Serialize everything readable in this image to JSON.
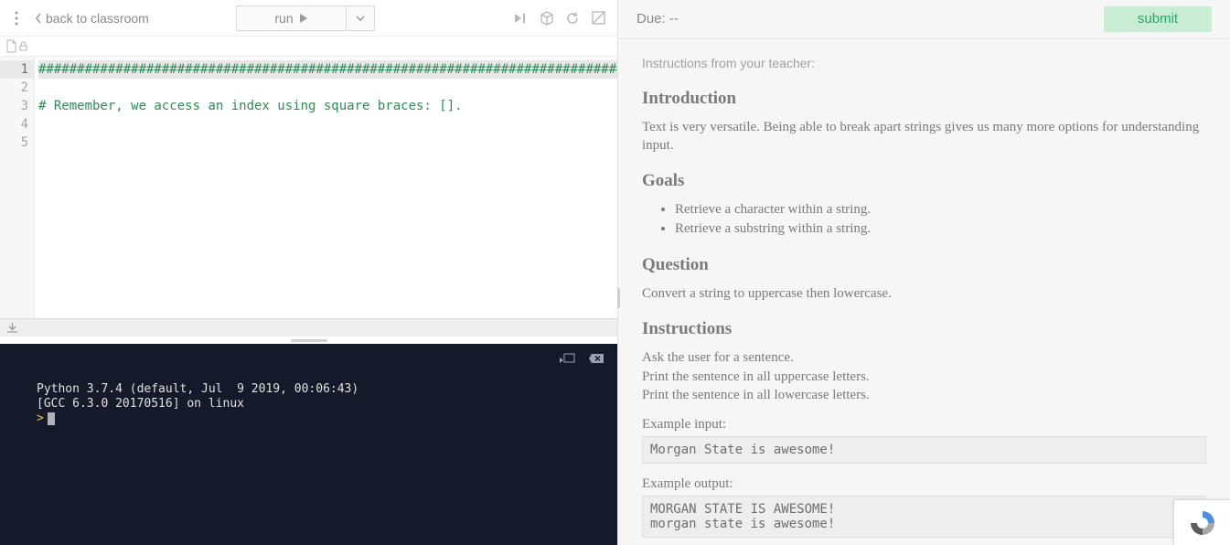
{
  "header": {
    "back_label": "back to classroom",
    "run_label": "run"
  },
  "editor": {
    "lines": [
      "################################################################################",
      "",
      "# Remember, we access an index using square braces: [].",
      "",
      ""
    ],
    "line_numbers": [
      "1",
      "2",
      "3",
      "4",
      "5"
    ],
    "active_line": 0
  },
  "terminal": {
    "lines": [
      "Python 3.7.4 (default, Jul  9 2019, 00:06:43)",
      "[GCC 6.3.0 20170516] on linux"
    ],
    "prompt": ">"
  },
  "assignment": {
    "due_label": "Due: --",
    "submit_label": "submit",
    "instructions_from": "Instructions from your teacher:",
    "sections": {
      "intro_h": "Introduction",
      "intro_p": "Text is very versatile. Being able to break apart strings gives us many more options for understanding input.",
      "goals_h": "Goals",
      "goals": [
        "Retrieve a character within a string.",
        "Retrieve a substring within a string."
      ],
      "question_h": "Question",
      "question_p": "Convert a string to uppercase then lowercase.",
      "instr_h": "Instructions",
      "instr_lines": [
        "Ask the user for a sentence.",
        "Print the sentence in all uppercase letters.",
        "Print the sentence in all lowercase letters."
      ],
      "ex_in_lbl": "Example input:",
      "ex_in": "Morgan State is awesome!",
      "ex_out_lbl": "Example output:",
      "ex_out": "MORGAN STATE IS AWESOME!\nmorgan state is awesome!"
    }
  },
  "icons": {
    "run_play": "▶",
    "dropdown": "▾",
    "step": "▶|",
    "menu": "⋮",
    "back": "◀"
  }
}
